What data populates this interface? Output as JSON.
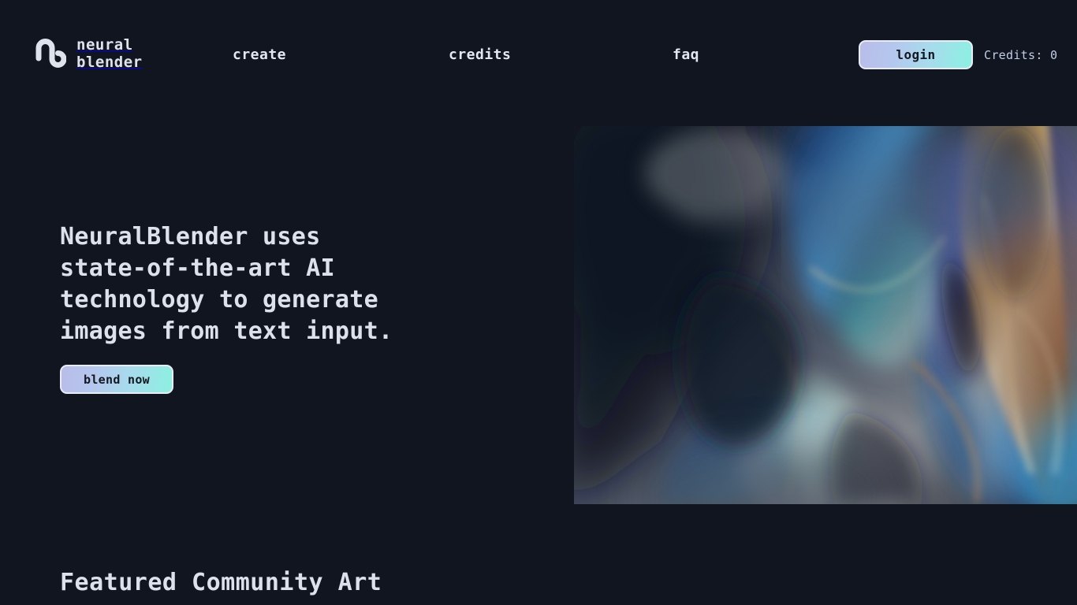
{
  "site": {
    "background_color": "#11151f",
    "text_color": "#dde1ec",
    "accent_gradient_start": "#b9bce9",
    "accent_gradient_end": "#8cf0e1"
  },
  "header": {
    "logo": {
      "icon": "neural-loop-logo-icon",
      "line1": "neural",
      "line2": "blender"
    },
    "nav": [
      {
        "label": "create"
      },
      {
        "label": "credits"
      },
      {
        "label": "faq"
      }
    ],
    "login_label": "login",
    "credits_label": "Credits: 0"
  },
  "hero": {
    "heading": "NeuralBlender uses\nstate-of-the-art AI\ntechnology to generate\nimages from text input.",
    "cta_label": "blend now",
    "art_alt": "abstract-iridescent-liquid-marble"
  },
  "featured": {
    "heading": "Featured Community Art"
  }
}
